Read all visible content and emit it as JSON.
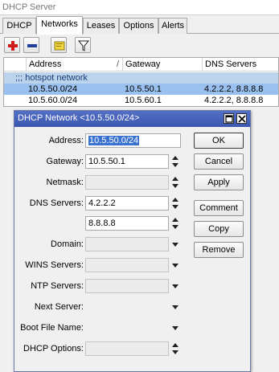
{
  "window": {
    "title": "DHCP Server"
  },
  "tabs": [
    {
      "label": "DHCP"
    },
    {
      "label": "Networks"
    },
    {
      "label": "Leases"
    },
    {
      "label": "Options"
    },
    {
      "label": "Alerts"
    }
  ],
  "active_tab": "Networks",
  "toolbar": {
    "add": "plus-icon",
    "remove": "minus-icon",
    "comment": "comment-icon",
    "filter": "filter-icon"
  },
  "table": {
    "columns": [
      "Address",
      "Gateway",
      "DNS Servers"
    ],
    "group_label": ";;; hotspot network",
    "rows": [
      {
        "address": "10.5.50.0/24",
        "gateway": "10.5.50.1",
        "dns": "4.2.2.2, 8.8.8.8"
      },
      {
        "address": "10.5.60.0/24",
        "gateway": "10.5.60.1",
        "dns": "4.2.2.2, 8.8.8.8"
      }
    ]
  },
  "dialog": {
    "title": "DHCP Network <10.5.50.0/24>",
    "labels": {
      "address": "Address:",
      "gateway": "Gateway:",
      "netmask": "Netmask:",
      "dns_servers": "DNS Servers:",
      "domain": "Domain:",
      "wins_servers": "WINS Servers:",
      "ntp_servers": "NTP Servers:",
      "next_server": "Next Server:",
      "boot_file_name": "Boot File Name:",
      "dhcp_options": "DHCP Options:"
    },
    "values": {
      "address": "10.5.50.0/24",
      "gateway": "10.5.50.1",
      "netmask": "",
      "dns_1": "4.2.2.2",
      "dns_2": "8.8.8.8"
    },
    "buttons": {
      "ok": "OK",
      "cancel": "Cancel",
      "apply": "Apply",
      "comment": "Comment",
      "copy": "Copy",
      "remove": "Remove"
    }
  }
}
